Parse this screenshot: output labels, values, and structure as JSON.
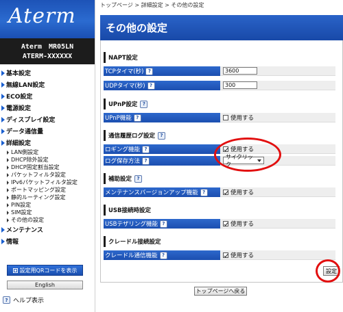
{
  "brand": {
    "logo": "Aterm",
    "model_line1": "Aterm　MR05LN",
    "model_line2": "ATERM-XXXXXX"
  },
  "nav": [
    {
      "label": "基本設定",
      "type": "main"
    },
    {
      "label": "無線LAN設定",
      "type": "main"
    },
    {
      "label": "ECO設定",
      "type": "main"
    },
    {
      "label": "電源設定",
      "type": "main"
    },
    {
      "label": "ディスプレイ設定",
      "type": "main"
    },
    {
      "label": "データ通信量",
      "type": "main"
    },
    {
      "label": "詳細設定",
      "type": "main"
    },
    {
      "label": "LAN側設定",
      "type": "sub"
    },
    {
      "label": "DHCP除外設定",
      "type": "sub"
    },
    {
      "label": "DHCP固定割当設定",
      "type": "sub"
    },
    {
      "label": "パケットフィルタ設定",
      "type": "sub"
    },
    {
      "label": "IPv6パケットフィルタ設定",
      "type": "sub"
    },
    {
      "label": "ポートマッピング設定",
      "type": "sub"
    },
    {
      "label": "静的ルーティング設定",
      "type": "sub"
    },
    {
      "label": "PIN設定",
      "type": "sub"
    },
    {
      "label": "SIM設定",
      "type": "sub"
    },
    {
      "label": "その他の設定",
      "type": "sub"
    },
    {
      "label": "メンテナンス",
      "type": "main"
    },
    {
      "label": "情報",
      "type": "main"
    }
  ],
  "sidebar": {
    "qr_label": "設定用QRコードを表示",
    "english_label": "English",
    "help_label": "ヘルプ表示",
    "help_icon": "?"
  },
  "breadcrumb": "トップページ > 詳細設定 > その他の設定",
  "page_title": "その他の設定",
  "sections": {
    "napt": {
      "title": "NAPT設定",
      "tcp_label": "TCPタイマ(秒)",
      "tcp_value": "3600",
      "udp_label": "UDPタイマ(秒)",
      "udp_value": "300"
    },
    "upnp": {
      "title": "UPnP設定",
      "func_label": "UPnP機能",
      "func_value": "使用する",
      "func_checked": false
    },
    "log": {
      "title": "通信履歴ログ設定",
      "logging_label": "ロギング機能",
      "logging_value": "使用する",
      "logging_checked": true,
      "save_label": "ログ保存方法",
      "save_value": "サイクリック"
    },
    "aux": {
      "title": "補助設定",
      "maint_label": "メンテナンスバージョンアップ機能",
      "maint_value": "使用する",
      "maint_checked": true
    },
    "usb": {
      "title": "USB接続時設定",
      "tether_label": "USBテザリング機能",
      "tether_value": "使用する",
      "tether_checked": true
    },
    "cradle": {
      "title": "クレードル接続設定",
      "comm_label": "クレードル通信機能",
      "comm_value": "使用する",
      "comm_checked": true
    }
  },
  "help_icon": "?",
  "buttons": {
    "set_label": "設定",
    "back_label": "トップページへ戻る"
  },
  "colors": {
    "accent": "#1c4fb0",
    "highlight": "#e20f0f"
  }
}
